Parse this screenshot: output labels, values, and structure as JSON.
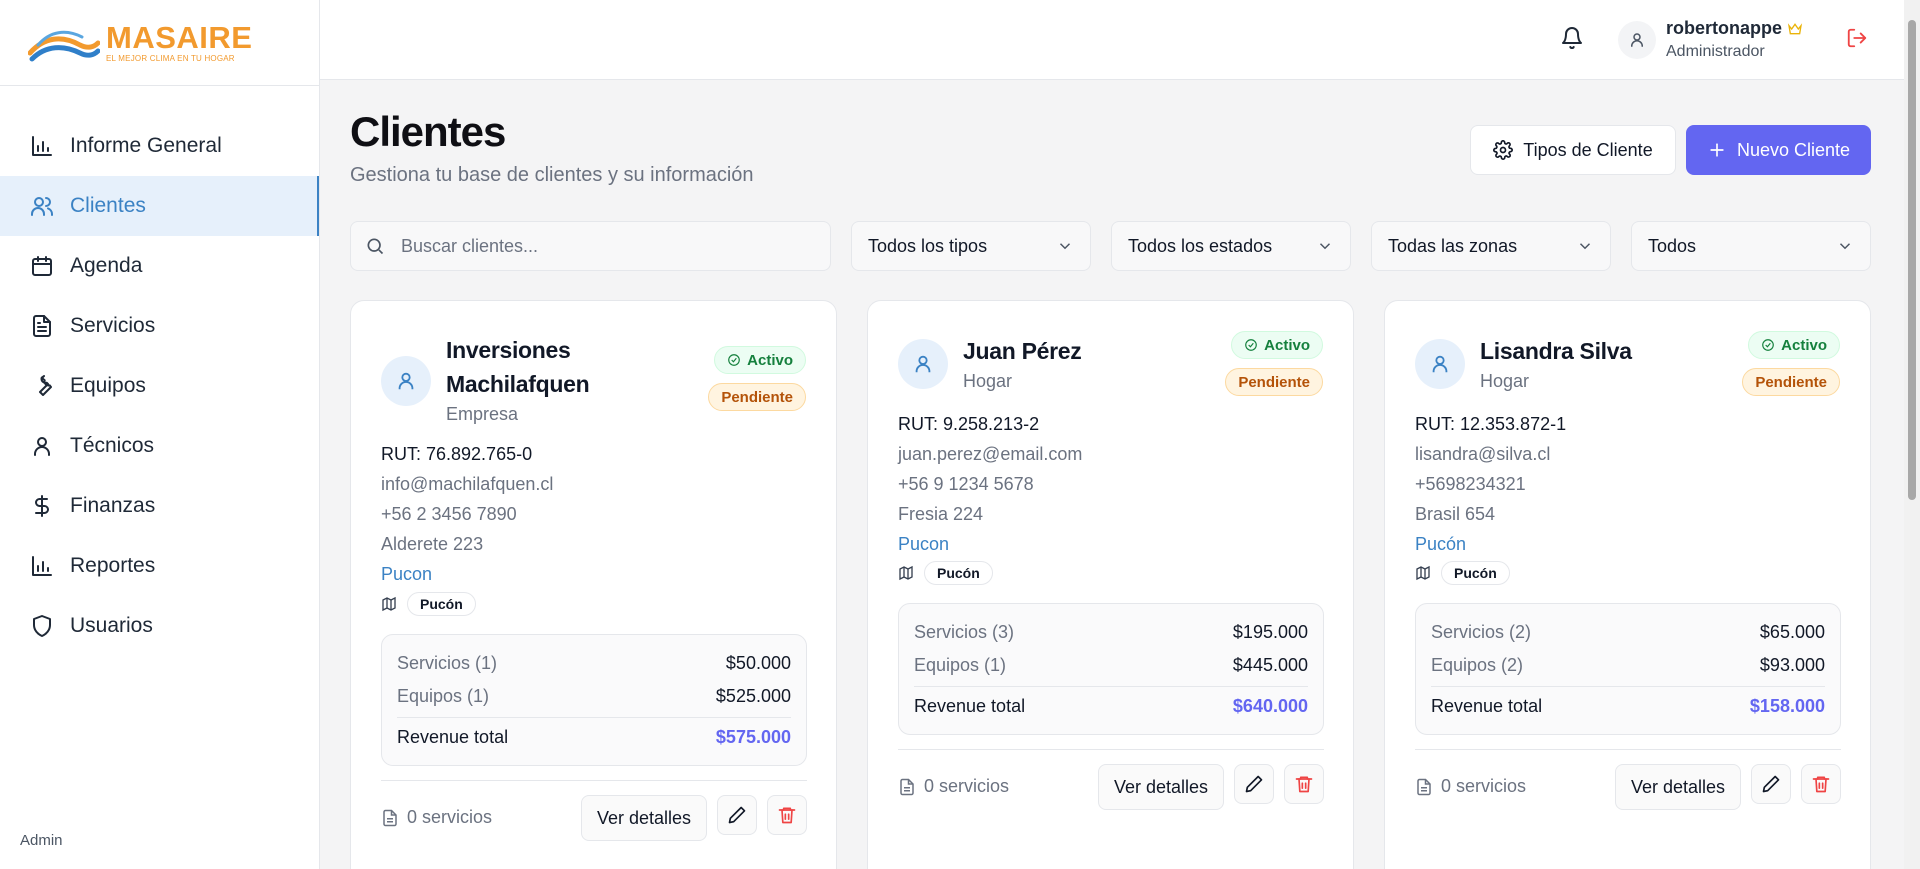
{
  "brand": {
    "name": "MASAIRE",
    "tagline": "EL MEJOR CLIMA EN TU HOGAR"
  },
  "sidebar": {
    "items": [
      {
        "label": "Informe General",
        "icon": "bar-chart-icon"
      },
      {
        "label": "Clientes",
        "icon": "users-icon",
        "active": true
      },
      {
        "label": "Agenda",
        "icon": "calendar-icon"
      },
      {
        "label": "Servicios",
        "icon": "file-text-icon"
      },
      {
        "label": "Equipos",
        "icon": "wrench-icon"
      },
      {
        "label": "Técnicos",
        "icon": "user-icon"
      },
      {
        "label": "Finanzas",
        "icon": "dollar-icon"
      },
      {
        "label": "Reportes",
        "icon": "bar-chart-icon"
      },
      {
        "label": "Usuarios",
        "icon": "shield-icon"
      }
    ],
    "footer": "Admin"
  },
  "topbar": {
    "username": "robertonappe",
    "role": "Administrador"
  },
  "page": {
    "title": "Clientes",
    "subtitle": "Gestiona tu base de clientes y su información",
    "btn_types": "Tipos de Cliente",
    "btn_new": "Nuevo Cliente"
  },
  "filters": {
    "search_placeholder": "Buscar clientes...",
    "type": "Todos los tipos",
    "status": "Todos los estados",
    "zone": "Todas las zonas",
    "other": "Todos"
  },
  "labels": {
    "active": "Activo",
    "pending": "Pendiente",
    "revenue_total": "Revenue total",
    "details": "Ver detalles"
  },
  "colors": {
    "accent": "#6366f1",
    "primary_blue": "#3b82c4",
    "brand_orange": "#f29a2e"
  },
  "clients": [
    {
      "name": "Inversiones Machilafquen",
      "type": "Empresa",
      "rut": "RUT: 76.892.765-0",
      "email": "info@machilafquen.cl",
      "phone": "+56 2 3456 7890",
      "address": "Alderete 223",
      "city": "Pucon",
      "zone": "Pucón",
      "services_label": "Servicios (1)",
      "services_value": "$50.000",
      "equipment_label": "Equipos (1)",
      "equipment_value": "$525.000",
      "revenue": "$575.000",
      "service_count": "0 servicios"
    },
    {
      "name": "Juan Pérez",
      "type": "Hogar",
      "rut": "RUT: 9.258.213-2",
      "email": "juan.perez@email.com",
      "phone": "+56 9 1234 5678",
      "address": "Fresia 224",
      "city": "Pucon",
      "zone": "Pucón",
      "services_label": "Servicios (3)",
      "services_value": "$195.000",
      "equipment_label": "Equipos (1)",
      "equipment_value": "$445.000",
      "revenue": "$640.000",
      "service_count": "0 servicios"
    },
    {
      "name": "Lisandra Silva",
      "type": "Hogar",
      "rut": "RUT: 12.353.872-1",
      "email": "lisandra@silva.cl",
      "phone": "+5698234321",
      "address": "Brasil 654",
      "city": "Pucón",
      "zone": "Pucón",
      "services_label": "Servicios (2)",
      "services_value": "$65.000",
      "equipment_label": "Equipos (2)",
      "equipment_value": "$93.000",
      "revenue": "$158.000",
      "service_count": "0 servicios"
    }
  ]
}
